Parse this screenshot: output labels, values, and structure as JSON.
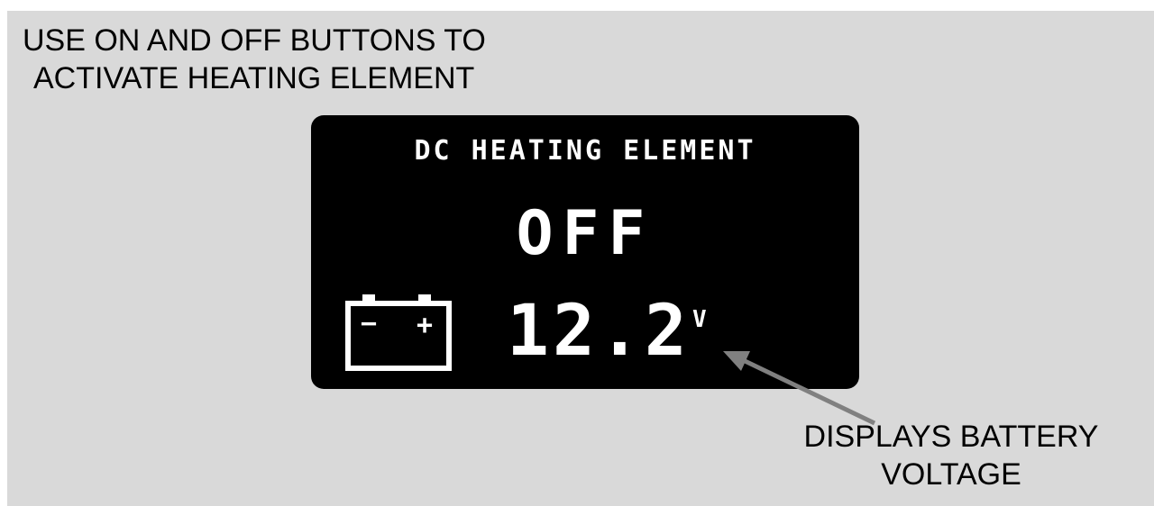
{
  "instruction": {
    "line1": "USE ON AND OFF BUTTONS TO",
    "line2": "ACTIVATE HEATING ELEMENT"
  },
  "display": {
    "title": "DC HEATING ELEMENT",
    "state": "OFF",
    "voltage": "12.2",
    "unit": "V",
    "battery_minus": "−",
    "battery_plus": "+"
  },
  "callout": {
    "line1": "DISPLAYS BATTERY",
    "line2": "VOLTAGE"
  },
  "colors": {
    "background": "#d9d9d9",
    "screen": "#000000",
    "screen_text": "#ffffff",
    "arrow": "#808080"
  },
  "icons": [
    "battery-icon",
    "callout-arrow"
  ]
}
